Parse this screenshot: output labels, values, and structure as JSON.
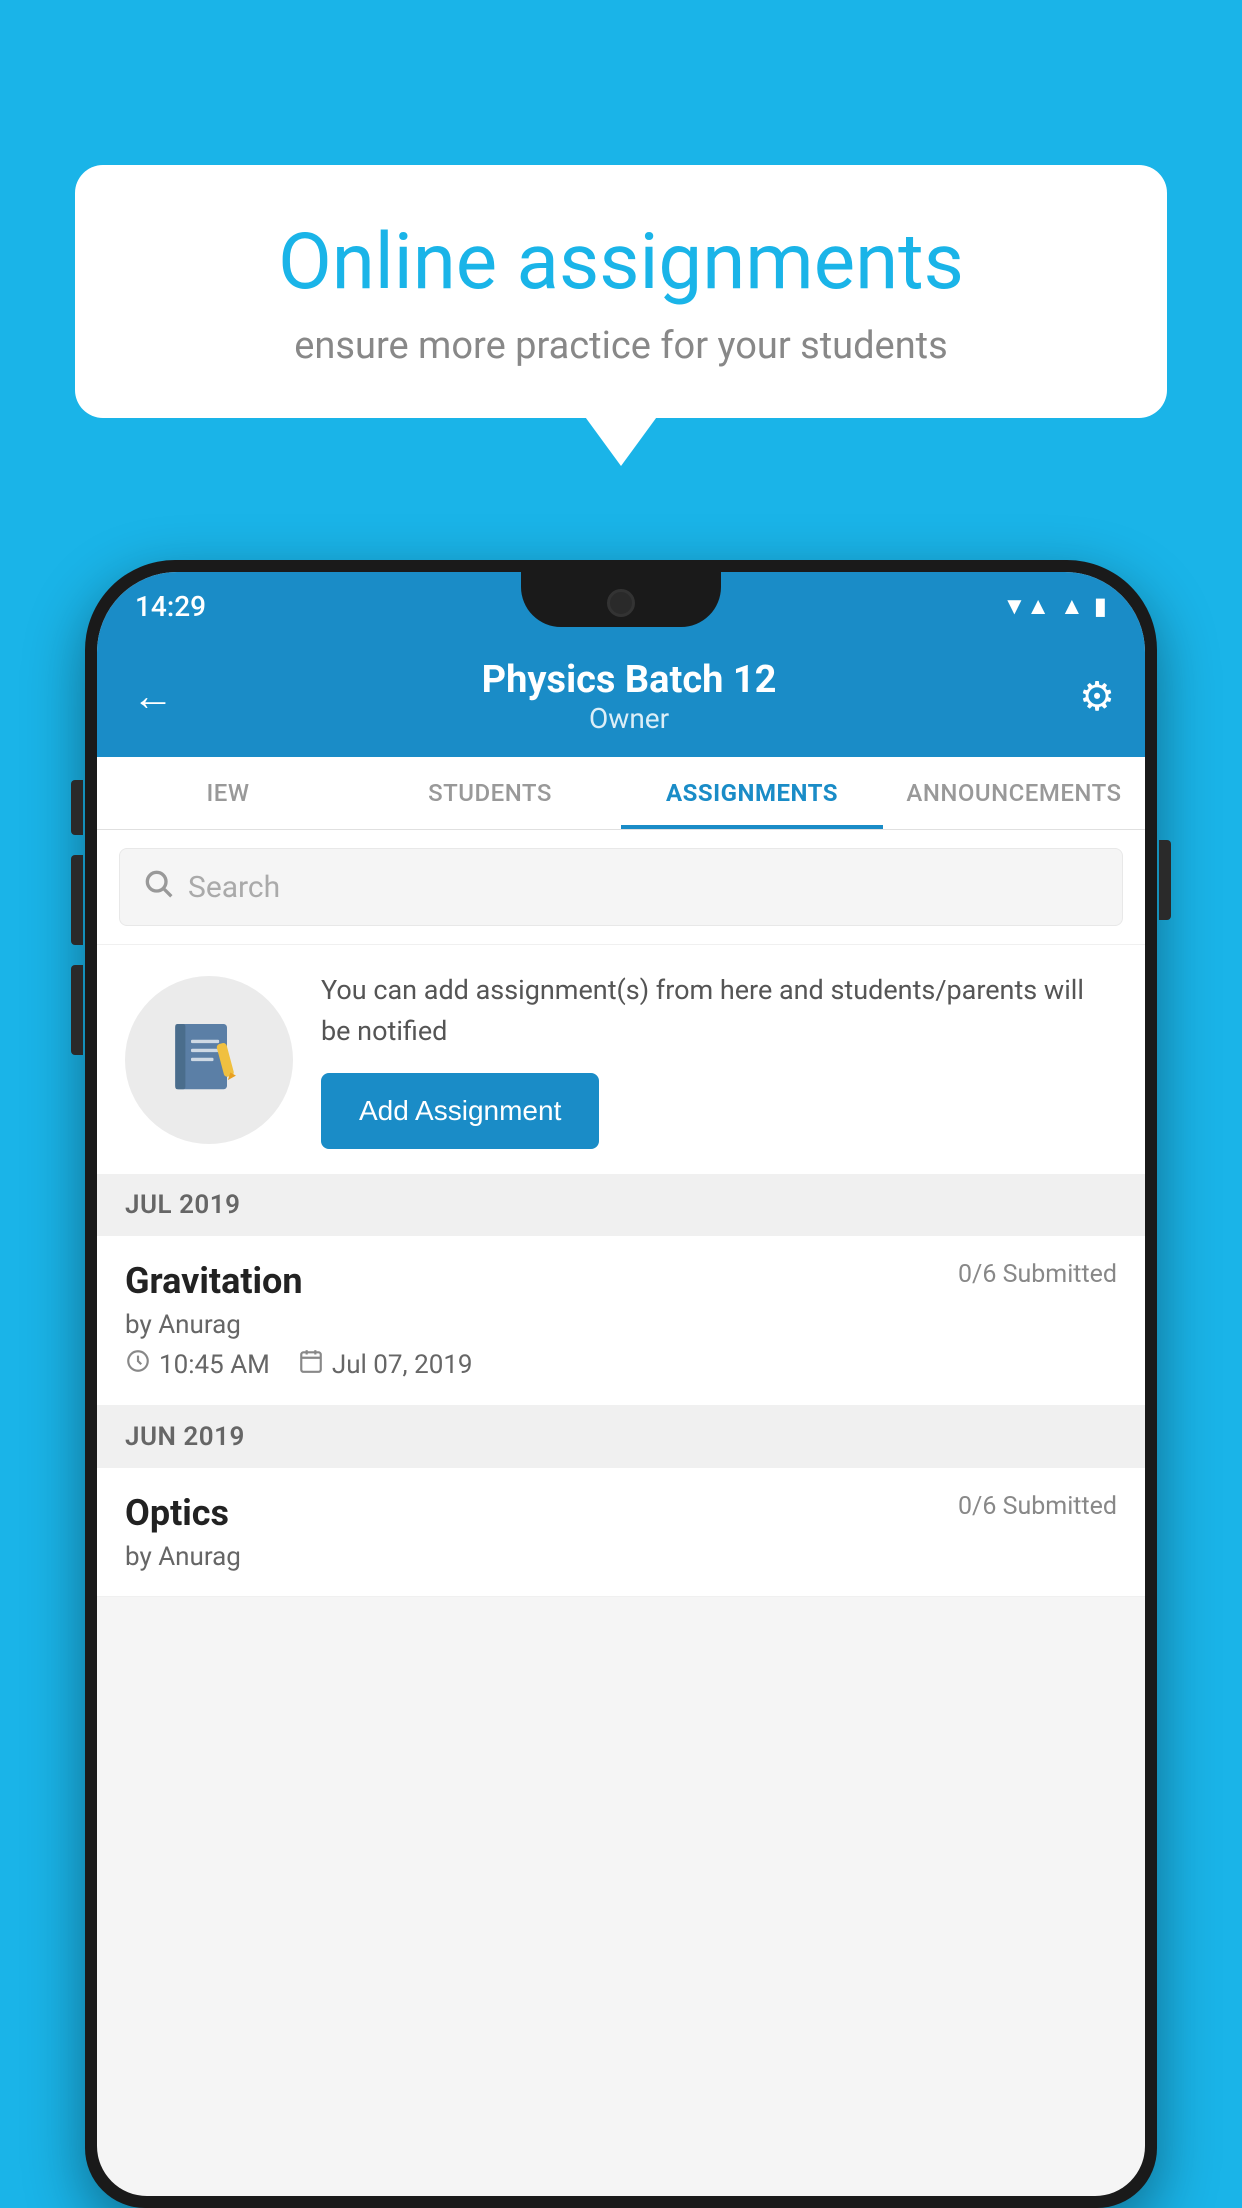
{
  "background_color": "#1ab4e8",
  "speech_bubble": {
    "title": "Online assignments",
    "subtitle": "ensure more practice for your students"
  },
  "status_bar": {
    "time": "14:29",
    "wifi": "▼",
    "signal": "▲",
    "battery": "▮"
  },
  "header": {
    "title": "Physics Batch 12",
    "subtitle": "Owner",
    "back_label": "←",
    "settings_label": "⚙"
  },
  "tabs": [
    {
      "id": "iew",
      "label": "IEW",
      "active": false
    },
    {
      "id": "students",
      "label": "STUDENTS",
      "active": false
    },
    {
      "id": "assignments",
      "label": "ASSIGNMENTS",
      "active": true
    },
    {
      "id": "announcements",
      "label": "ANNOUNCEMENTS",
      "active": false
    }
  ],
  "search": {
    "placeholder": "Search"
  },
  "info_card": {
    "text": "You can add assignment(s) from here and students/parents will be notified",
    "button_label": "Add Assignment"
  },
  "sections": [
    {
      "header": "JUL 2019",
      "assignments": [
        {
          "title": "Gravitation",
          "submitted": "0/6 Submitted",
          "by": "by Anurag",
          "time": "10:45 AM",
          "date": "Jul 07, 2019"
        }
      ]
    },
    {
      "header": "JUN 2019",
      "assignments": [
        {
          "title": "Optics",
          "submitted": "0/6 Submitted",
          "by": "by Anurag",
          "time": "",
          "date": ""
        }
      ]
    }
  ]
}
